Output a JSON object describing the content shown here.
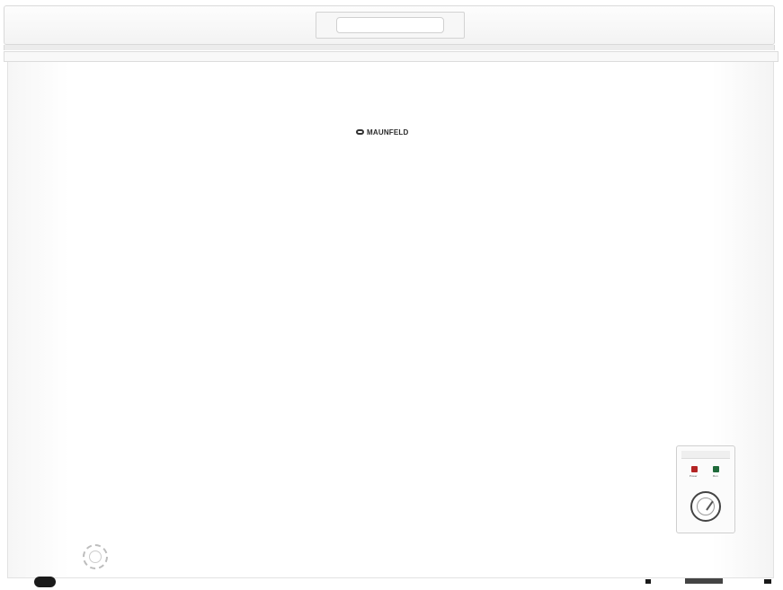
{
  "product": {
    "brand": "MAUNFELD",
    "type": "chest-freezer"
  },
  "control_panel": {
    "indicator_power_label": "Power",
    "indicator_run_label": "Run",
    "colors": {
      "power_led": "#b32323",
      "run_led": "#1f6a3a"
    }
  },
  "icons": {
    "logo": "maunfeld-logo-icon",
    "knob": "thermostat-knob-icon",
    "drain": "drain-plug-icon",
    "wheel": "wheel-icon"
  }
}
